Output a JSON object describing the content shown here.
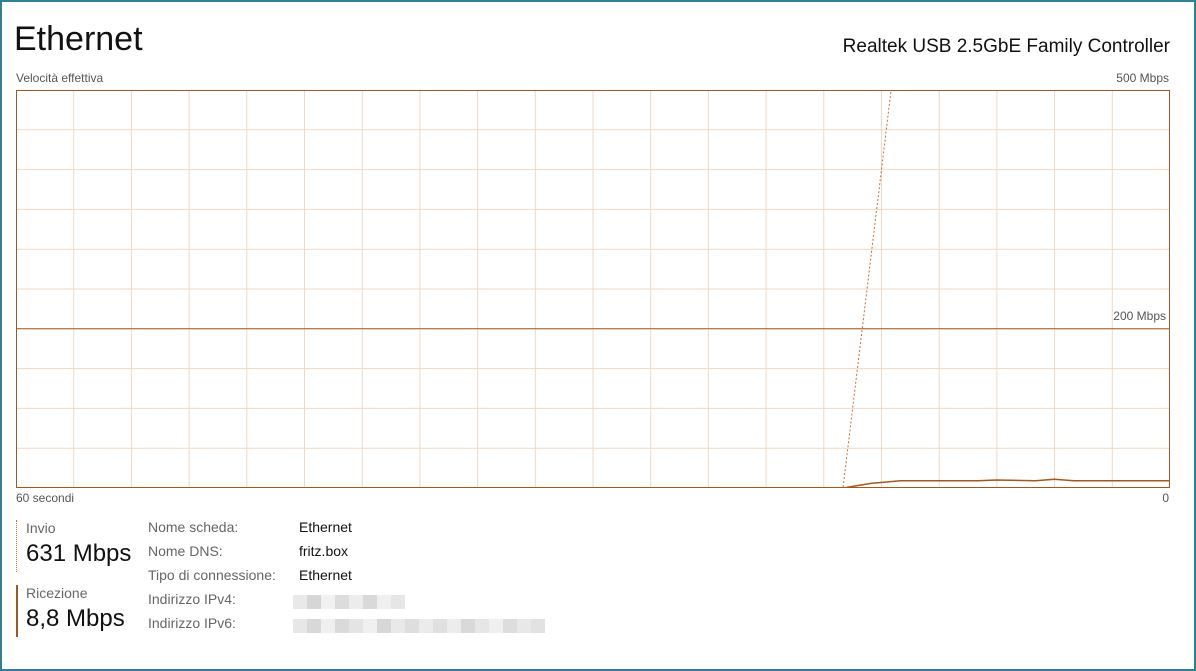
{
  "title": "Ethernet",
  "adapter_name": "Realtek USB 2.5GbE Family Controller",
  "graph": {
    "label_top_left": "Velocità effettiva",
    "label_top_right": "500 Mbps",
    "label_mid_right": "200 Mbps",
    "label_bottom_left": "60 secondi",
    "label_bottom_right": "0",
    "colors": {
      "border": "#a0581e",
      "grid": "#efd9c6",
      "send": "#d36a2e",
      "receive": "#a0581e"
    }
  },
  "chart_data": {
    "type": "line",
    "xlabel": "60 secondi",
    "ylabel": "Velocità effettiva",
    "xlim": [
      60,
      0
    ],
    "series": [
      {
        "name": "Invio",
        "style": "dotted",
        "x": [
          60,
          17,
          14.5
        ],
        "y": [
          0,
          0,
          510
        ]
      },
      {
        "name": "Ricezione",
        "style": "solid",
        "x": [
          60,
          17,
          15.5,
          14,
          10,
          9,
          7,
          6,
          5,
          0
        ],
        "y": [
          0,
          0,
          6,
          9,
          9,
          10,
          9,
          11,
          9,
          9
        ]
      }
    ]
  },
  "stats": {
    "send": {
      "label": "Invio",
      "value": "631 Mbps"
    },
    "receive": {
      "label": "Ricezione",
      "value": "8,8 Mbps"
    }
  },
  "properties": [
    {
      "key": "Nome scheda:",
      "value": "Ethernet"
    },
    {
      "key": "Nome DNS:",
      "value": "fritz.box"
    },
    {
      "key": "Tipo di connessione:",
      "value": "Ethernet"
    },
    {
      "key": "Indirizzo IPv4:",
      "value": ""
    },
    {
      "key": "Indirizzo IPv6:",
      "value": ""
    }
  ]
}
